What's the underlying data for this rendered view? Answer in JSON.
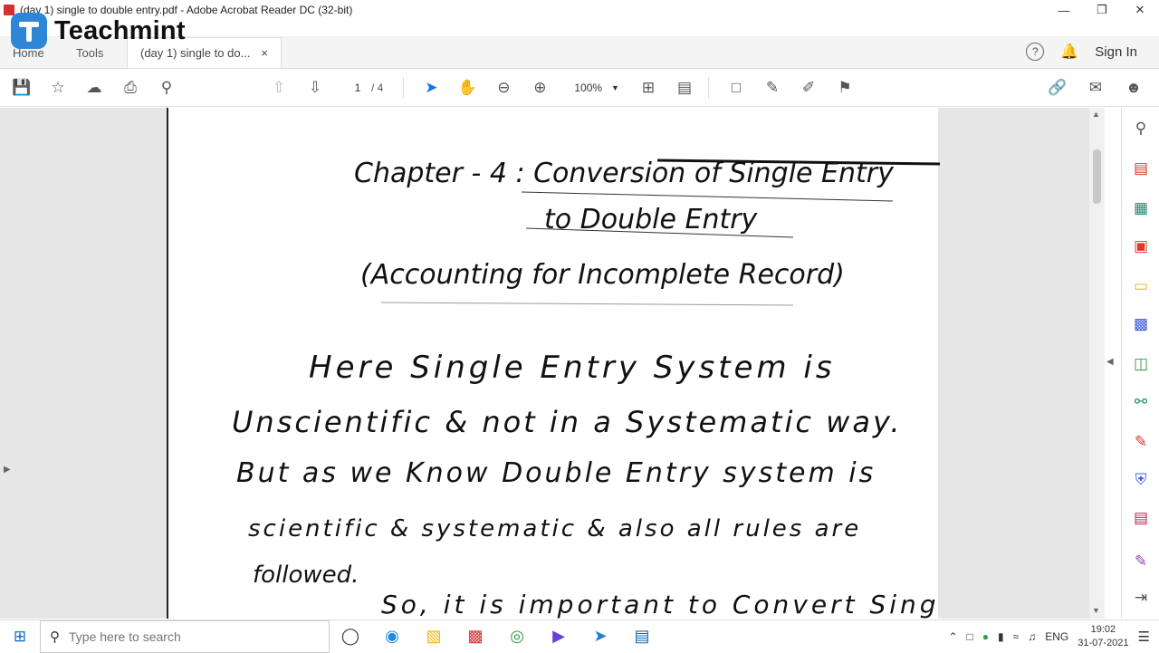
{
  "window": {
    "title": "(day 1) single to double entry.pdf - Adobe Acrobat Reader DC (32-bit)",
    "controls": [
      "—",
      "❐",
      "✕"
    ]
  },
  "watermark": {
    "text": "Teachmint"
  },
  "tabs": {
    "home": "Home",
    "tools": "Tools",
    "document": "(day 1) single to do...",
    "close": "×"
  },
  "header_right": {
    "help": "?",
    "signin": "Sign In"
  },
  "toolbar": {
    "page_current": "1",
    "page_total": "/ 4",
    "zoom": "100%"
  },
  "document": {
    "lines": [
      "Chapter - 4 : Conversion of Single Entry",
      "to Double Entry",
      "(Accounting for Incomplete Record)",
      "Here Single Entry System is",
      "Unscientific & not in a Systematic way.",
      "But as we Know Double Entry system is",
      "scientific & systematic & also all rules are",
      "followed.",
      "So, it is important to Convert Single"
    ]
  },
  "taskbar": {
    "search_placeholder": "Type here to search",
    "language": "ENG",
    "time": "19:02",
    "date": "31-07-2021"
  }
}
